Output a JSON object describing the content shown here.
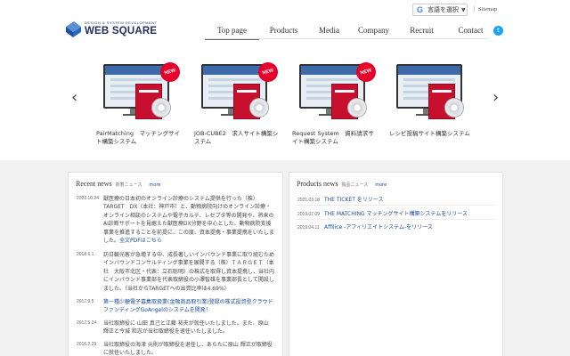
{
  "header": {
    "logo_tagline": "DESIGN & SYSTEM DEVELOPMENT",
    "logo_name": "WEB SQUARE",
    "translate_label": "言語を選択",
    "sitemap_label": "Sitemap"
  },
  "nav": {
    "items": [
      "Top page",
      "Products",
      "Media",
      "Company",
      "Recruit",
      "Contact"
    ],
    "active": "Top page"
  },
  "carousel": {
    "slides": [
      {
        "caption": "PairMatching　マッチングサイト構築システム",
        "badge": "NEW"
      },
      {
        "caption": "JOB-CUBE2　求人サイト構築システム",
        "badge": "NEW"
      },
      {
        "caption": "Request System　資料請求サイト構築システム",
        "badge": "NEW"
      },
      {
        "caption": "レシピ投稿サイト構築システム",
        "badge": ""
      }
    ]
  },
  "recent_news": {
    "title": "Recent news",
    "subtitle": "新着ニュース",
    "more": "more",
    "items": [
      {
        "date": "2023.10.24",
        "text": "獣医療の日本初のオンライン診療のシステム提供を行った（株）TARGET　DX（本社：神戸市）と、動物病院向けのオンライン診療・オンライン相談のシステムや電子カルテ、レセプタ等の開発や、将来のAI診断サポートを見据えた獣医療DX分野を中心とした、動物病院支援事業を推進することを前提に、この度、資本提携・事業提携をいたしました。",
        "link": "全文PDFはこちら"
      },
      {
        "date": "2018.6.1",
        "text": "訪日観光客が急増する中、成長著しいインバウンド事業に取り組むためインバウンドコンサルティング事業を展開する（株）ＴＡＲＧＥＴ（本社　大阪市北区・代表：立石聡明）の株式を取得し資本提携し、当社内にインバウンド事業部を代表取締役の小澤智雄を事業部長として開設しました。（当社からTARGETへの出資比率は4.69%）",
        "link": ""
      },
      {
        "date": "2017.9.5",
        "text": "第一種少額電子募集取扱業(金融商品取引業)登録の株式投資型クラウドファンディングGoAngelのシステムを開発！",
        "link": ""
      },
      {
        "date": "2017.5.24",
        "text": "当社取締役に 山田 真己と江藤 祐夫が就任いたしました。また、原山 輝正と今城 和志が当社取締役を退任いたしました。",
        "link": ""
      },
      {
        "date": "2016.2.29",
        "text": "当社取締役の海津 元則が取締役を退任し、あらたに原山 輝正が取締役に就任いたしました。",
        "link": ""
      }
    ]
  },
  "products_news": {
    "title": "Products news",
    "subtitle": "製品ニュース",
    "more": "more",
    "items": [
      {
        "date": "2021.03.18",
        "title": "THE TICKET をリリース"
      },
      {
        "date": "2019.07.09",
        "title": "THE MATCHING マッチングサイト構築システムをリリース"
      },
      {
        "date": "2019.04.11",
        "title": "Affilice -アフィリエイトシステム-をリリース"
      }
    ]
  },
  "colors": {
    "link": "#1a4fa0",
    "badge": "#e4002b",
    "box": "#c8102e",
    "twitter": "#1da1f2",
    "section_bg": "#f1f1f1"
  },
  "icons": [
    "logo-mark-icon",
    "google-g-icon",
    "twitter-icon",
    "chevron-left-icon",
    "chevron-right-icon"
  ]
}
